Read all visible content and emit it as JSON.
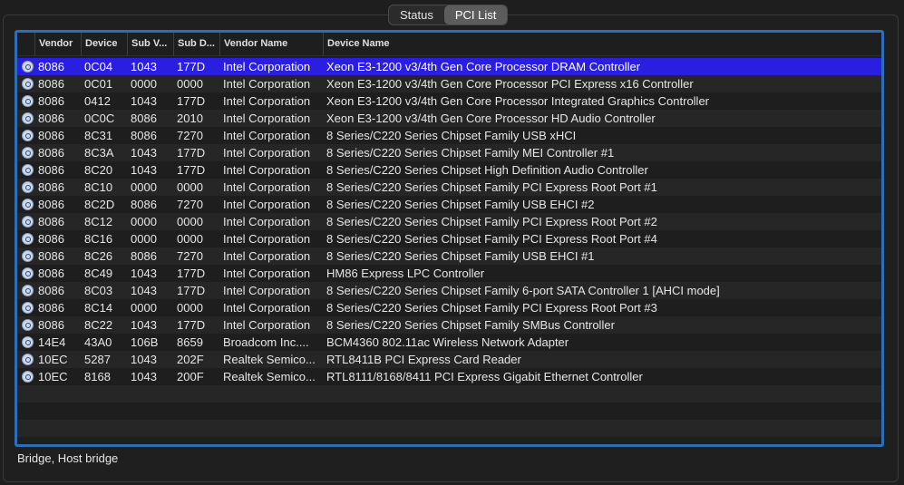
{
  "tabs": [
    {
      "label": "Status",
      "active": false
    },
    {
      "label": "PCI List",
      "active": true
    }
  ],
  "table": {
    "columns": [
      "Vendor",
      "Device",
      "Sub V...",
      "Sub D...",
      "Vendor Name",
      "Device Name"
    ],
    "rows": [
      {
        "icon": "pci-device-icon",
        "vendor": "8086",
        "device": "0C04",
        "subv": "1043",
        "subd": "177D",
        "vname": "Intel Corporation",
        "dname": "Xeon E3-1200 v3/4th Gen Core Processor DRAM Controller",
        "selected": true
      },
      {
        "icon": "pci-device-icon",
        "vendor": "8086",
        "device": "0C01",
        "subv": "0000",
        "subd": "0000",
        "vname": "Intel Corporation",
        "dname": "Xeon E3-1200 v3/4th Gen Core Processor PCI Express x16 Controller"
      },
      {
        "icon": "pci-device-icon",
        "vendor": "8086",
        "device": "0412",
        "subv": "1043",
        "subd": "177D",
        "vname": "Intel Corporation",
        "dname": "Xeon E3-1200 v3/4th Gen Core Processor Integrated Graphics Controller"
      },
      {
        "icon": "pci-device-icon",
        "vendor": "8086",
        "device": "0C0C",
        "subv": "8086",
        "subd": "2010",
        "vname": "Intel Corporation",
        "dname": "Xeon E3-1200 v3/4th Gen Core Processor HD Audio Controller"
      },
      {
        "icon": "pci-device-icon",
        "vendor": "8086",
        "device": "8C31",
        "subv": "8086",
        "subd": "7270",
        "vname": "Intel Corporation",
        "dname": "8 Series/C220 Series Chipset Family USB xHCI"
      },
      {
        "icon": "pci-device-icon",
        "vendor": "8086",
        "device": "8C3A",
        "subv": "1043",
        "subd": "177D",
        "vname": "Intel Corporation",
        "dname": "8 Series/C220 Series Chipset Family MEI Controller #1"
      },
      {
        "icon": "pci-device-icon",
        "vendor": "8086",
        "device": "8C20",
        "subv": "1043",
        "subd": "177D",
        "vname": "Intel Corporation",
        "dname": "8 Series/C220 Series Chipset High Definition Audio Controller"
      },
      {
        "icon": "pci-device-icon",
        "vendor": "8086",
        "device": "8C10",
        "subv": "0000",
        "subd": "0000",
        "vname": "Intel Corporation",
        "dname": "8 Series/C220 Series Chipset Family PCI Express Root Port #1"
      },
      {
        "icon": "pci-device-icon",
        "vendor": "8086",
        "device": "8C2D",
        "subv": "8086",
        "subd": "7270",
        "vname": "Intel Corporation",
        "dname": "8 Series/C220 Series Chipset Family USB EHCI #2"
      },
      {
        "icon": "pci-device-icon",
        "vendor": "8086",
        "device": "8C12",
        "subv": "0000",
        "subd": "0000",
        "vname": "Intel Corporation",
        "dname": "8 Series/C220 Series Chipset Family PCI Express Root Port #2"
      },
      {
        "icon": "pci-device-icon",
        "vendor": "8086",
        "device": "8C16",
        "subv": "0000",
        "subd": "0000",
        "vname": "Intel Corporation",
        "dname": "8 Series/C220 Series Chipset Family PCI Express Root Port #4"
      },
      {
        "icon": "pci-device-icon",
        "vendor": "8086",
        "device": "8C26",
        "subv": "8086",
        "subd": "7270",
        "vname": "Intel Corporation",
        "dname": "8 Series/C220 Series Chipset Family USB EHCI #1"
      },
      {
        "icon": "pci-device-icon",
        "vendor": "8086",
        "device": "8C49",
        "subv": "1043",
        "subd": "177D",
        "vname": "Intel Corporation",
        "dname": "HM86 Express LPC Controller"
      },
      {
        "icon": "pci-device-icon",
        "vendor": "8086",
        "device": "8C03",
        "subv": "1043",
        "subd": "177D",
        "vname": "Intel Corporation",
        "dname": "8 Series/C220 Series Chipset Family 6-port SATA Controller 1 [AHCI mode]"
      },
      {
        "icon": "pci-device-icon",
        "vendor": "8086",
        "device": "8C14",
        "subv": "0000",
        "subd": "0000",
        "vname": "Intel Corporation",
        "dname": "8 Series/C220 Series Chipset Family PCI Express Root Port #3"
      },
      {
        "icon": "pci-device-icon",
        "vendor": "8086",
        "device": "8C22",
        "subv": "1043",
        "subd": "177D",
        "vname": "Intel Corporation",
        "dname": "8 Series/C220 Series Chipset Family SMBus Controller"
      },
      {
        "icon": "pci-device-icon",
        "vendor": "14E4",
        "device": "43A0",
        "subv": "106B",
        "subd": "8659",
        "vname": "Broadcom Inc....",
        "dname": "BCM4360 802.11ac Wireless Network Adapter"
      },
      {
        "icon": "pci-device-icon",
        "vendor": "10EC",
        "device": "5287",
        "subv": "1043",
        "subd": "202F",
        "vname": "Realtek Semico...",
        "dname": "RTL8411B PCI Express Card Reader"
      },
      {
        "icon": "pci-device-icon",
        "vendor": "10EC",
        "device": "8168",
        "subv": "1043",
        "subd": "200F",
        "vname": "Realtek Semico...",
        "dname": "RTL8111/8168/8411 PCI Express Gigabit Ethernet Controller"
      }
    ]
  },
  "status_text": "Bridge, Host bridge",
  "colors": {
    "selection": "#2a1ee0",
    "focus_ring": "#2c6fb8",
    "background": "#1e1e1e"
  }
}
